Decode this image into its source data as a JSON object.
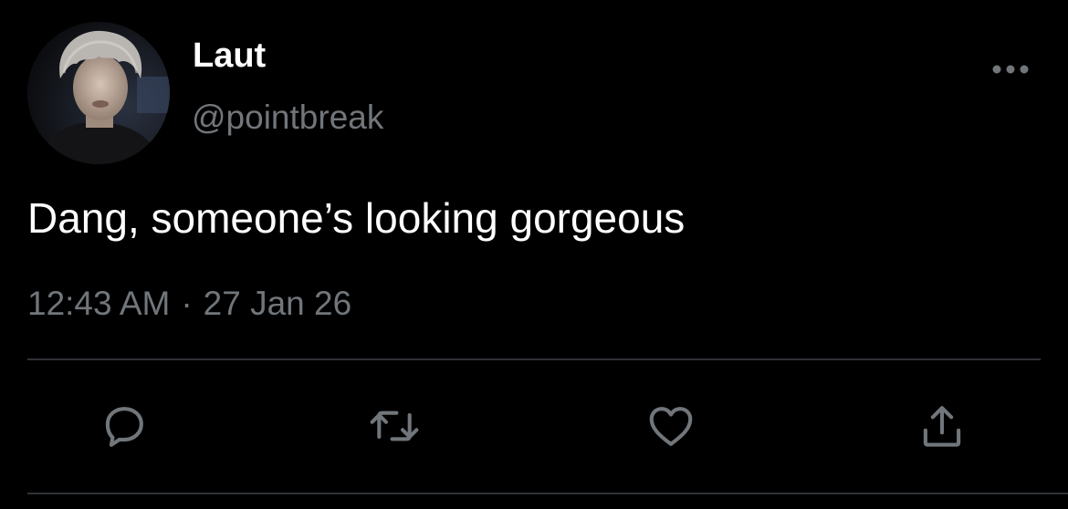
{
  "tweet": {
    "display_name": "Laut",
    "handle": "@pointbreak",
    "text": "Dang, someone’s looking gorgeous",
    "time": "12:43 AM",
    "separator": "·",
    "date": "27 Jan 26"
  },
  "icons": {
    "avatar": "profile-photo",
    "more": "more-horizontal-icon",
    "reply": "reply-icon",
    "retweet": "retweet-icon",
    "like": "heart-icon",
    "share": "share-icon"
  },
  "colors": {
    "background": "#000000",
    "primary_text": "#ffffff",
    "secondary_text": "#71767b",
    "divider": "#2f3336",
    "icon": "#71767b"
  }
}
